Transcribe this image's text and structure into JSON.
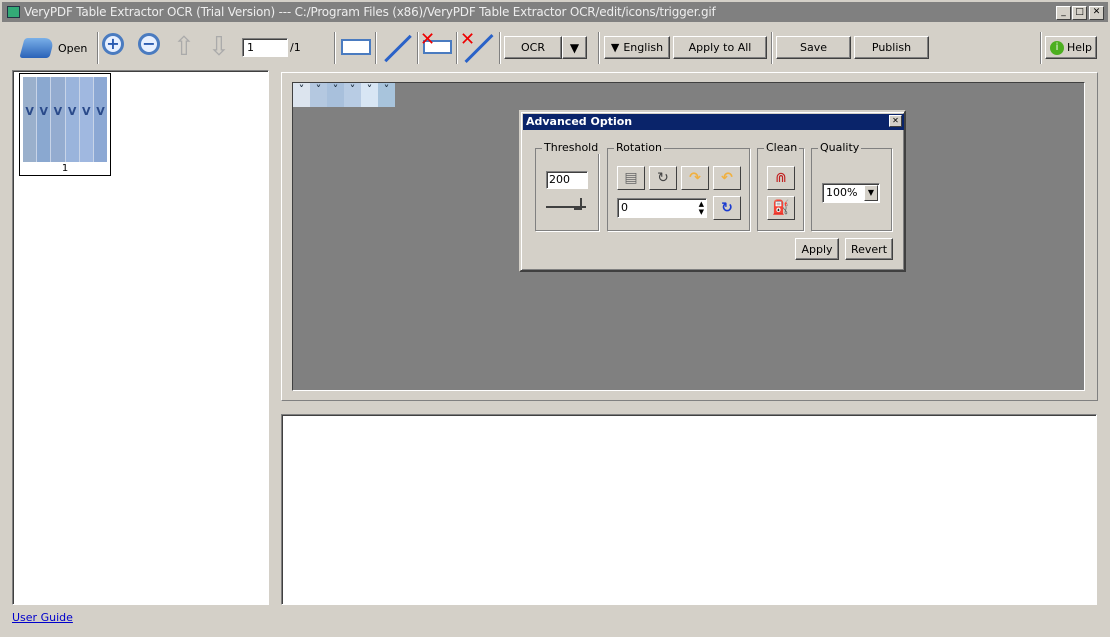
{
  "window": {
    "title": "VeryPDF Table Extractor OCR (Trial Version) --- C:/Program Files (x86)/VeryPDF Table Extractor OCR/edit/icons/trigger.gif",
    "minimize": "_",
    "maximize": "□",
    "close": "✕"
  },
  "toolbar": {
    "open_label": "Open",
    "page_value": "1",
    "page_total": "/1",
    "ocr_label": "OCR",
    "language_label": "English",
    "apply_all_label": "Apply to All",
    "save_label": "Save",
    "publish_label": "Publish",
    "help_label": "Help"
  },
  "thumbnails": [
    {
      "label": "1"
    }
  ],
  "column_markers": [
    "˅",
    "˅",
    "˅",
    "˅",
    "˅",
    "˅"
  ],
  "dialog": {
    "title": "Advanced Option",
    "close": "✕",
    "threshold": {
      "label": "Threshold",
      "value": "200"
    },
    "rotation": {
      "label": "Rotation",
      "angle": "0"
    },
    "clean": {
      "label": "Clean"
    },
    "quality": {
      "label": "Quality",
      "value": "100%"
    },
    "apply_label": "Apply",
    "revert_label": "Revert"
  },
  "footer": {
    "user_guide": "User Guide"
  },
  "colors": {
    "dialog_title": "#0a246a",
    "canvas": "#808080",
    "link": "#0000cc"
  }
}
